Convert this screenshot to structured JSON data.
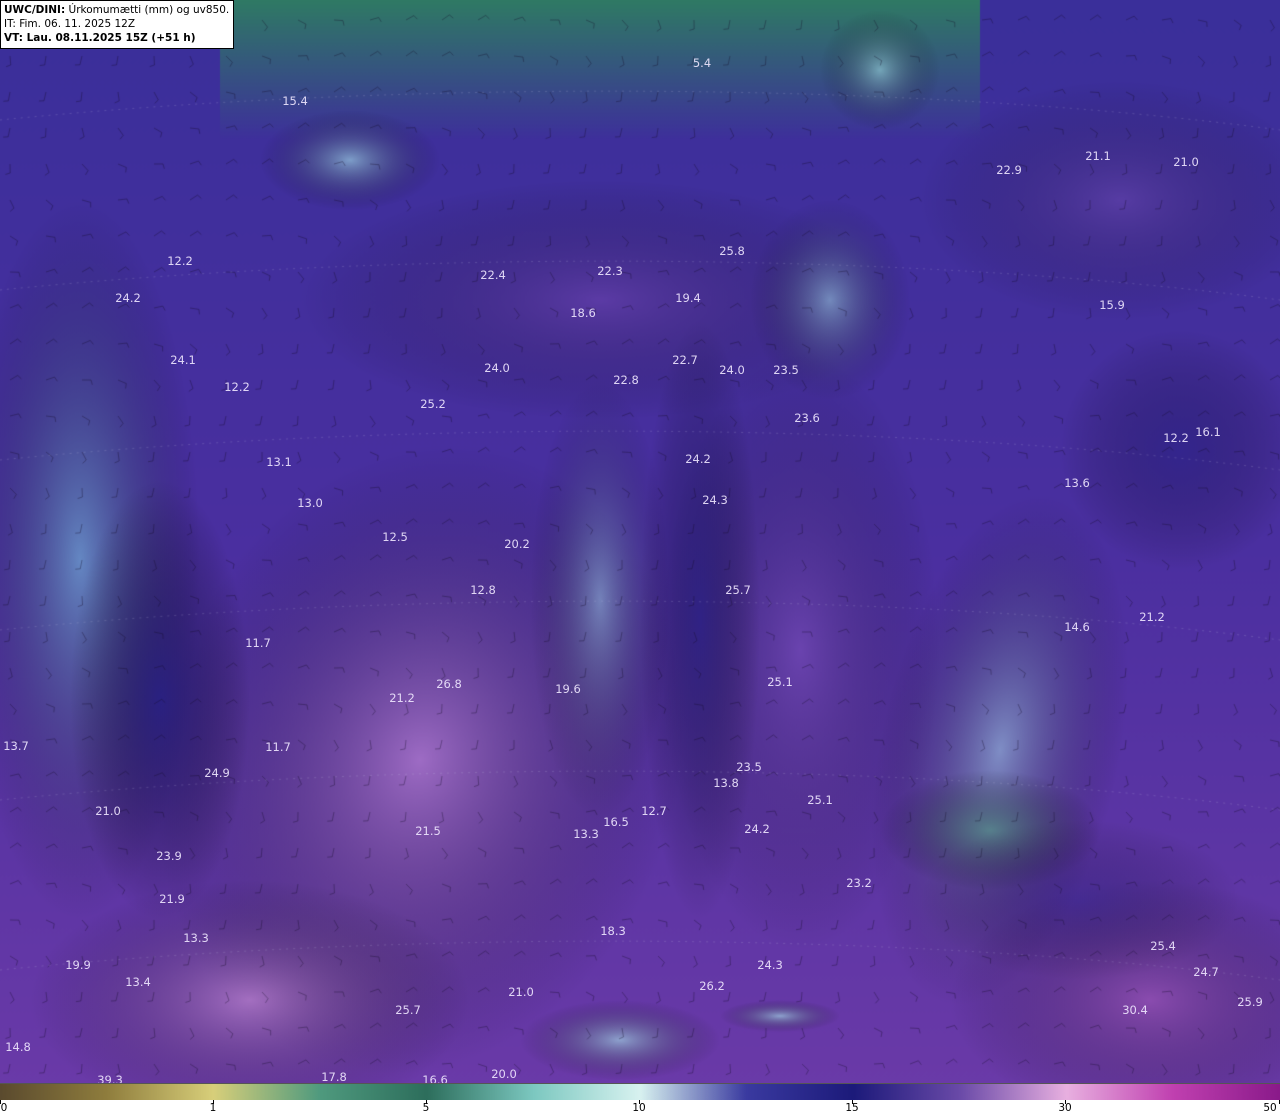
{
  "header": {
    "product": "UWC/DINI:",
    "description": "Úrkomumætti (mm) og uv850.",
    "init_time": "IT: Fim. 06. 11. 2025 12Z",
    "valid_time": "VT: Lau. 08.11.2025 15Z (+51 h)"
  },
  "map_labels": [
    {
      "id": "l1",
      "text": "5.4"
    },
    {
      "id": "l2",
      "text": "15.4"
    },
    {
      "id": "l3",
      "text": "22.9"
    },
    {
      "id": "l4",
      "text": "21.1"
    },
    {
      "id": "l5",
      "text": "21.0"
    },
    {
      "id": "l6",
      "text": "12.2"
    },
    {
      "id": "l7",
      "text": "24.2"
    },
    {
      "id": "l8",
      "text": "22.4"
    },
    {
      "id": "l9",
      "text": "22.3"
    },
    {
      "id": "l10",
      "text": "25.8"
    },
    {
      "id": "l11",
      "text": "19.4"
    },
    {
      "id": "l12",
      "text": "18.6"
    },
    {
      "id": "l13",
      "text": "15.9"
    },
    {
      "id": "l14",
      "text": "24.1"
    },
    {
      "id": "l15",
      "text": "24.0"
    },
    {
      "id": "l16",
      "text": "22.7"
    },
    {
      "id": "l17",
      "text": "24.0"
    },
    {
      "id": "l18",
      "text": "23.5"
    },
    {
      "id": "l19",
      "text": "22.8"
    },
    {
      "id": "l20",
      "text": "12.2"
    },
    {
      "id": "l21",
      "text": "25.2"
    },
    {
      "id": "l22",
      "text": "23.6"
    },
    {
      "id": "l23",
      "text": "12.2"
    },
    {
      "id": "l24",
      "text": "16.1"
    },
    {
      "id": "l25",
      "text": "13.1"
    },
    {
      "id": "l26",
      "text": "24.2"
    },
    {
      "id": "l27",
      "text": "13.6"
    },
    {
      "id": "l28",
      "text": "13.0"
    },
    {
      "id": "l29",
      "text": "24.3"
    },
    {
      "id": "l30",
      "text": "12.5"
    },
    {
      "id": "l31",
      "text": "20.2"
    },
    {
      "id": "l32",
      "text": "12.8"
    },
    {
      "id": "l33",
      "text": "25.7"
    },
    {
      "id": "l34",
      "text": "21.2"
    },
    {
      "id": "l35",
      "text": "14.6"
    },
    {
      "id": "l36",
      "text": "11.7"
    },
    {
      "id": "l37",
      "text": "26.8"
    },
    {
      "id": "l38",
      "text": "19.6"
    },
    {
      "id": "l39",
      "text": "25.1"
    },
    {
      "id": "l40",
      "text": "21.2"
    },
    {
      "id": "l41",
      "text": "13.7"
    },
    {
      "id": "l42",
      "text": "11.7"
    },
    {
      "id": "l43",
      "text": "24.9"
    },
    {
      "id": "l44",
      "text": "23.5"
    },
    {
      "id": "l45",
      "text": "13.8"
    },
    {
      "id": "l46",
      "text": "21.0"
    },
    {
      "id": "l47",
      "text": "25.1"
    },
    {
      "id": "l48",
      "text": "21.5"
    },
    {
      "id": "l49",
      "text": "16.5"
    },
    {
      "id": "l50",
      "text": "12.7"
    },
    {
      "id": "l51",
      "text": "13.3"
    },
    {
      "id": "l52",
      "text": "24.2"
    },
    {
      "id": "l53",
      "text": "23.9"
    },
    {
      "id": "l54",
      "text": "23.2"
    },
    {
      "id": "l55",
      "text": "21.9"
    },
    {
      "id": "l56",
      "text": "13.3"
    },
    {
      "id": "l57",
      "text": "18.3"
    },
    {
      "id": "l58",
      "text": "19.9"
    },
    {
      "id": "l59",
      "text": "24.3"
    },
    {
      "id": "l60",
      "text": "13.4"
    },
    {
      "id": "l61",
      "text": "26.2"
    },
    {
      "id": "l62",
      "text": "21.0"
    },
    {
      "id": "l63",
      "text": "25.7"
    },
    {
      "id": "l64",
      "text": "24.7"
    },
    {
      "id": "l65",
      "text": "25.9"
    },
    {
      "id": "l66",
      "text": "14.8"
    },
    {
      "id": "l67",
      "text": "17.8"
    },
    {
      "id": "l68",
      "text": "16.6"
    },
    {
      "id": "l69",
      "text": "20.0"
    },
    {
      "id": "l70",
      "text": "39.3"
    },
    {
      "id": "l71",
      "text": "25.4"
    },
    {
      "id": "l72",
      "text": "30.4"
    }
  ],
  "colorbar": {
    "ticks": [
      "0",
      "1",
      "5",
      "10",
      "15",
      "30",
      "50"
    ],
    "stops": [
      "#5a4a2e",
      "#8f7d3d",
      "#d8cf7a",
      "#4f9a7e",
      "#2d6e5c",
      "#7cc8c0",
      "#d8f2f0",
      "#3a3aa0",
      "#1c1a7a",
      "#6a4aa8",
      "#e8b0e0",
      "#c040b0",
      "#8a1a8a"
    ]
  }
}
